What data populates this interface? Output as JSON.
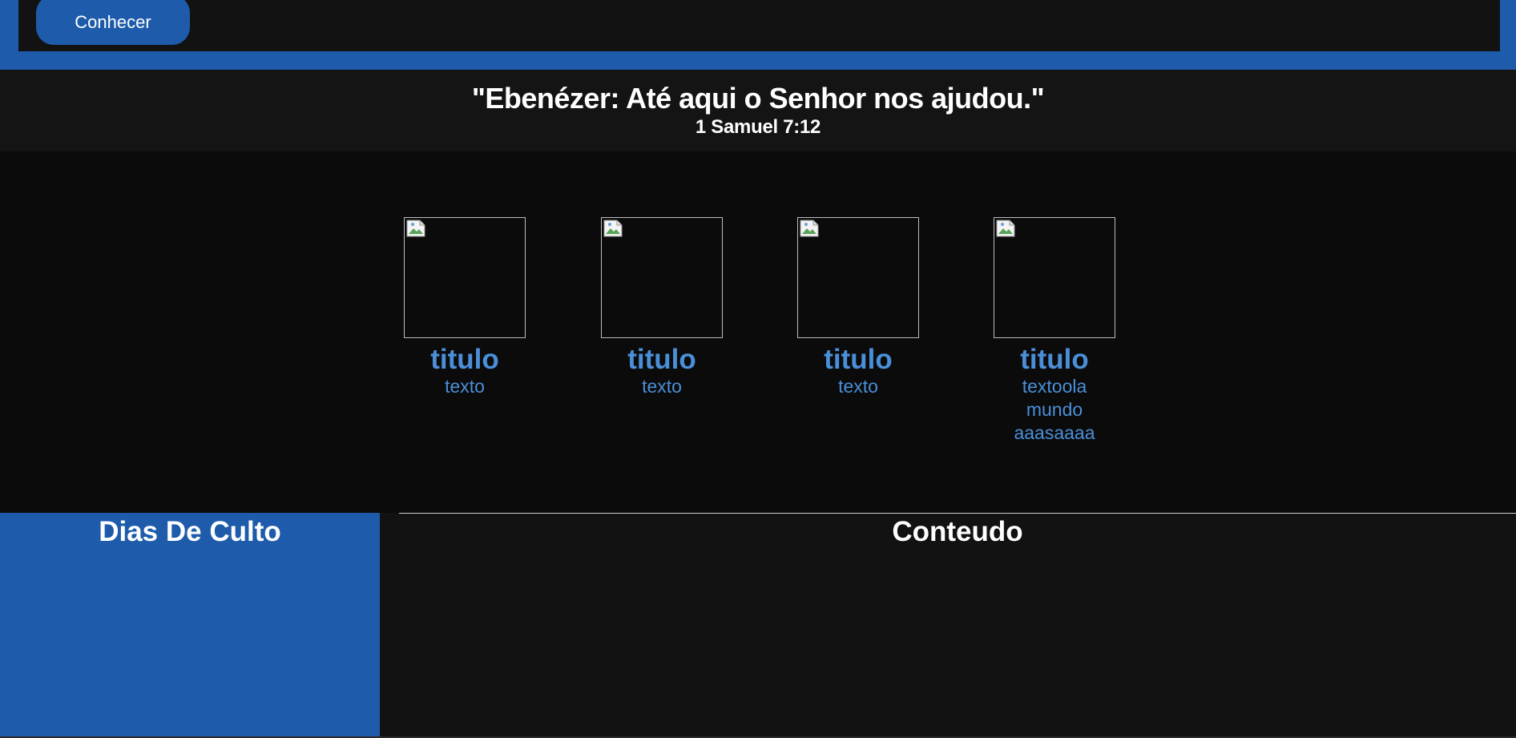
{
  "header": {
    "button_label": "Conhecer"
  },
  "verse": {
    "quote": "\"Ebenézer: Até aqui o Senhor nos ajudou.\"",
    "reference": "1 Samuel 7:12"
  },
  "cards": [
    {
      "title": "titulo",
      "text": "texto"
    },
    {
      "title": "titulo",
      "text": "texto"
    },
    {
      "title": "titulo",
      "text": "texto"
    },
    {
      "title": "titulo",
      "text": "textoola mundo aaasaaaa"
    }
  ],
  "sections": {
    "dias_title": "Dias De Culto",
    "conteudo_title": "Conteudo"
  },
  "colors": {
    "brand_blue": "#1e5cab",
    "link_blue": "#4a8fd8",
    "background": "#121212"
  }
}
